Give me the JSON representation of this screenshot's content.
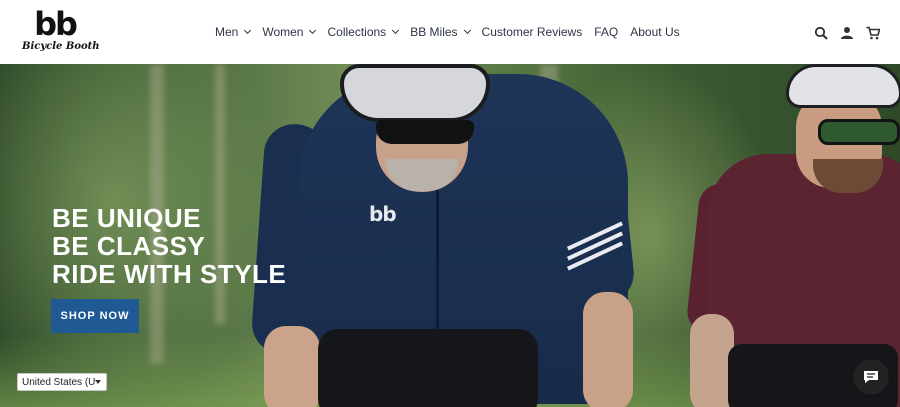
{
  "brand": {
    "logo_mark": "bb",
    "logo_text": "Bicycle Booth"
  },
  "nav": {
    "items": [
      {
        "label": "Men",
        "has_dropdown": true
      },
      {
        "label": "Women",
        "has_dropdown": true
      },
      {
        "label": "Collections",
        "has_dropdown": true
      },
      {
        "label": "BB Miles",
        "has_dropdown": true
      },
      {
        "label": "Customer Reviews",
        "has_dropdown": false
      },
      {
        "label": "FAQ",
        "has_dropdown": false
      },
      {
        "label": "About Us",
        "has_dropdown": false
      }
    ]
  },
  "header_icons": [
    "search-icon",
    "account-icon",
    "cart-icon"
  ],
  "hero": {
    "lines": [
      "BE UNIQUE",
      "BE CLASSY",
      "RIDE WITH STYLE"
    ],
    "cta_label": "SHOP NOW",
    "jersey_logo": "bb"
  },
  "country_selector": {
    "value": "United States (U"
  },
  "chat": {
    "icon": "chat-icon"
  },
  "colors": {
    "cta_blue": "#1f5a94",
    "nav_text": "#2d3748"
  }
}
